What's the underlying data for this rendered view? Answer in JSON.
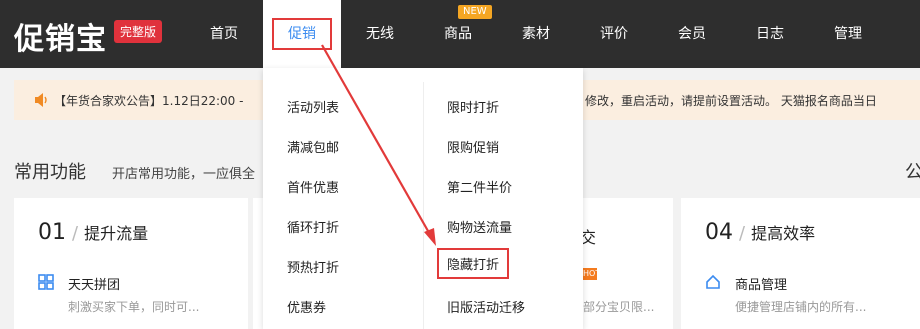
{
  "logo": {
    "text": "促销宝",
    "badge": "完整版"
  },
  "nav": {
    "items": [
      "首页",
      "促销",
      "无线",
      "商品",
      "素材",
      "评价",
      "会员",
      "日志",
      "管理"
    ],
    "new_badge": "NEW"
  },
  "notice": {
    "text": "【年货合家欢公告】1.12日22:00 -",
    "text_tail": "修改，重启活动，请提前设置活动。 天猫报名商品当日"
  },
  "common": {
    "title": "常用功能",
    "desc": "开店常用功能，一应俱全",
    "side_char": "公"
  },
  "cards": [
    {
      "num": "01",
      "title": "提升流量",
      "feature": "天天拼团",
      "feature_desc": "刺激买家下单，同时可...",
      "icon": "grid-icon"
    },
    {
      "num": "04",
      "title": "提高效率",
      "feature": "商品管理",
      "feature_desc": "便捷管理店铺内的所有...",
      "icon": "house-icon"
    }
  ],
  "peek": {
    "card3_title_char": "交",
    "card3_desc": "部分宝贝限..."
  },
  "dropdown": {
    "left": [
      "活动列表",
      "满减包邮",
      "首件优惠",
      "循环打折",
      "预热打折",
      "优惠券"
    ],
    "right": [
      "限时打折",
      "限购促销",
      "第二件半价",
      "购物送流量",
      "隐藏打折",
      "旧版活动迁移"
    ]
  },
  "colors": {
    "topbar": "#2e2e2e",
    "accent": "#3c8cf0",
    "highlight": "#e23a3a",
    "notice_bg": "#fbeee0"
  }
}
